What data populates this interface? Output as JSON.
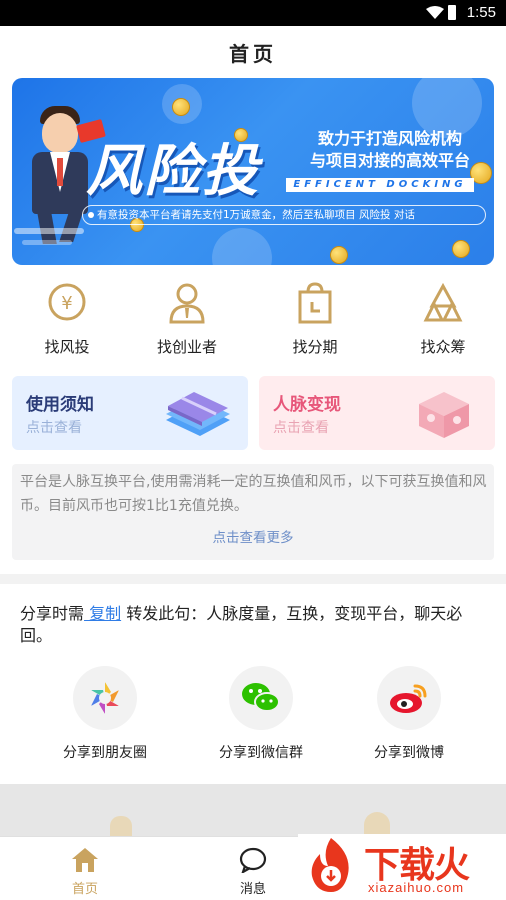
{
  "status_bar": {
    "time": "1:55"
  },
  "header": {
    "title": "首页"
  },
  "banner": {
    "headline": "风险投",
    "tagline_line1": "致力于打造风险机构",
    "tagline_line2": "与项目对接的高效平台",
    "english": "EFFICENT DOCKING",
    "notice": "有意投资本平台者请先支付1万诚意金，然后至私聊项目 风险投 对话",
    "envelope_glyph": "¥"
  },
  "nav": {
    "items": [
      {
        "label": "找风投",
        "icon": "yuan-coin-icon"
      },
      {
        "label": "找创业者",
        "icon": "person-icon"
      },
      {
        "label": "找分期",
        "icon": "bag-clock-icon"
      },
      {
        "label": "找众筹",
        "icon": "mountain-icon"
      }
    ],
    "yuan_glyph": "¥"
  },
  "cards": {
    "notice": {
      "title": "使用须知",
      "subtitle": "点击查看"
    },
    "network": {
      "title": "人脉变现",
      "subtitle": "点击查看"
    }
  },
  "info": {
    "text": "平台是人脉互换平台,使用需消耗一定的互换值和风币，以下可获互换值和风币。目前风币也可按1比1充值兑换。",
    "more": "点击查看更多"
  },
  "share": {
    "prefix": "分享时需",
    "copy_link": " 复制",
    "suffix": " 转发此句：人脉度量，互换，变现平台，聊天必回。",
    "targets": [
      {
        "label": "分享到朋友圈",
        "icon": "moments-icon"
      },
      {
        "label": "分享到微信群",
        "icon": "wechat-icon"
      },
      {
        "label": "分享到微博",
        "icon": "weibo-icon"
      }
    ]
  },
  "tabbar": {
    "items": [
      {
        "label": "首页",
        "icon": "home-icon",
        "active": true
      },
      {
        "label": "消息",
        "icon": "message-icon",
        "active": false
      }
    ]
  },
  "watermark": {
    "cn": "下载火",
    "en": "xiazaihuo.com"
  },
  "colors": {
    "accent_gold": "#c9a35f",
    "link_blue": "#2f7ce6",
    "tab_active": "#c9a35f",
    "banner_blue": "#1e74e8"
  }
}
